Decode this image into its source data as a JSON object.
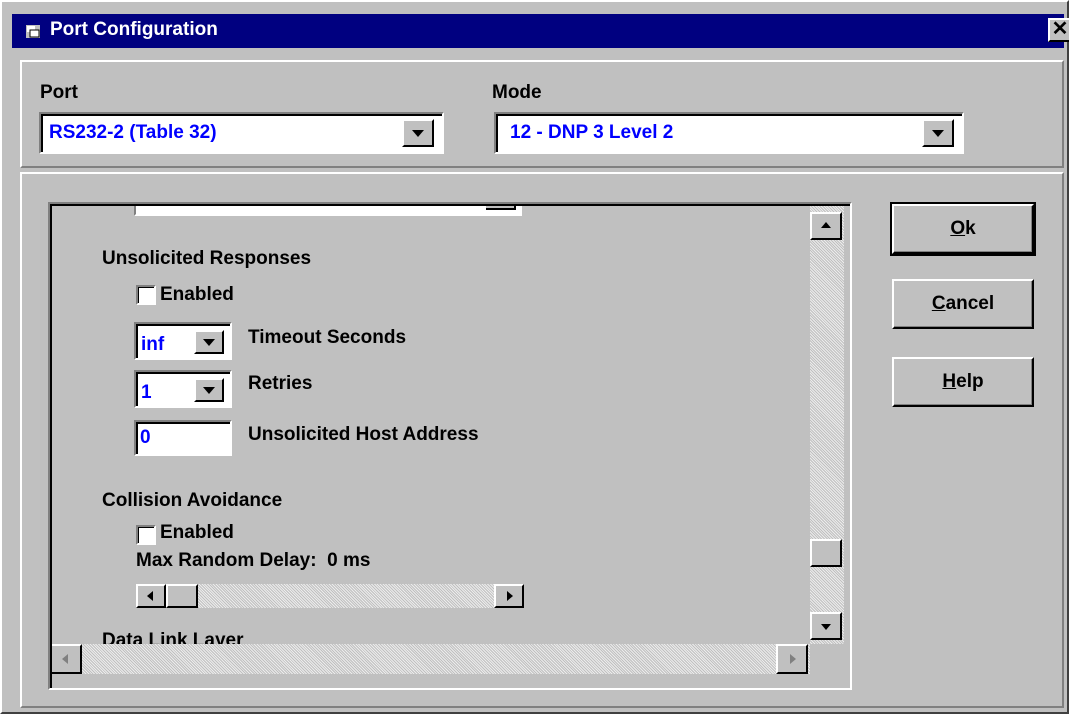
{
  "window": {
    "title": "Port Configuration",
    "title_icon": "app-icon",
    "close_glyph": "✕",
    "colors": {
      "titlebar": "#000080",
      "face": "#c0c0c0",
      "value_text": "#0000ff"
    }
  },
  "port": {
    "label": "Port",
    "value": "RS232-2 (Table 32)"
  },
  "mode": {
    "label": "Mode",
    "value": "12 - DNP 3 Level 2"
  },
  "unsolicited": {
    "heading": "Unsolicited Responses",
    "enabled_label": "Enabled",
    "enabled_checked": false,
    "timeout": {
      "value": "inf",
      "label": "Timeout Seconds"
    },
    "retries": {
      "value": "1",
      "label": "Retries"
    },
    "host_address": {
      "value": "0",
      "label": "Unsolicited Host Address"
    }
  },
  "collision": {
    "heading": "Collision Avoidance",
    "enabled_label": "Enabled",
    "enabled_checked": false,
    "max_delay_label": "Max Random Delay:",
    "max_delay_value": "0 ms",
    "slider_value_fraction": 0
  },
  "next_section": {
    "heading": "Data Link Layer"
  },
  "scroll": {
    "vertical_position_fraction": 0.87
  },
  "buttons": {
    "ok": {
      "mnemonic": "O",
      "rest": "k"
    },
    "cancel": {
      "mnemonic": "C",
      "rest": "ancel"
    },
    "help": {
      "mnemonic": "H",
      "rest": "elp"
    }
  }
}
